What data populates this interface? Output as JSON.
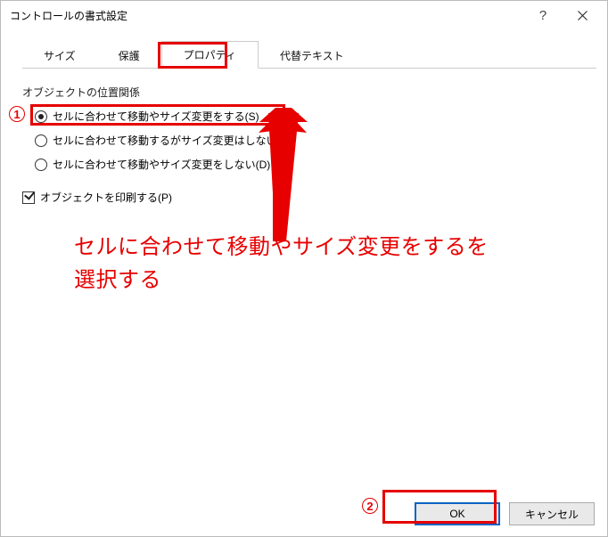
{
  "titlebar": {
    "title": "コントロールの書式設定",
    "help": "?",
    "close_name": "close-icon"
  },
  "tabs": {
    "size": "サイズ",
    "protection": "保護",
    "properties": "プロパティ",
    "alt_text": "代替テキスト"
  },
  "panel": {
    "section_label": "オブジェクトの位置関係",
    "radio1": "セルに合わせて移動やサイズ変更をする(S)",
    "radio2": "セルに合わせて移動するがサイズ変更はしない(M)",
    "radio3": "セルに合わせて移動やサイズ変更をしない(D)",
    "checkbox_print": "オブジェクトを印刷する(P)"
  },
  "buttons": {
    "ok": "OK",
    "cancel": "キャンセル"
  },
  "annotations": {
    "num1": "1",
    "num2": "2",
    "text_line1": "セルに合わせて移動やサイズ変更をするを",
    "text_line2": "選択する"
  }
}
